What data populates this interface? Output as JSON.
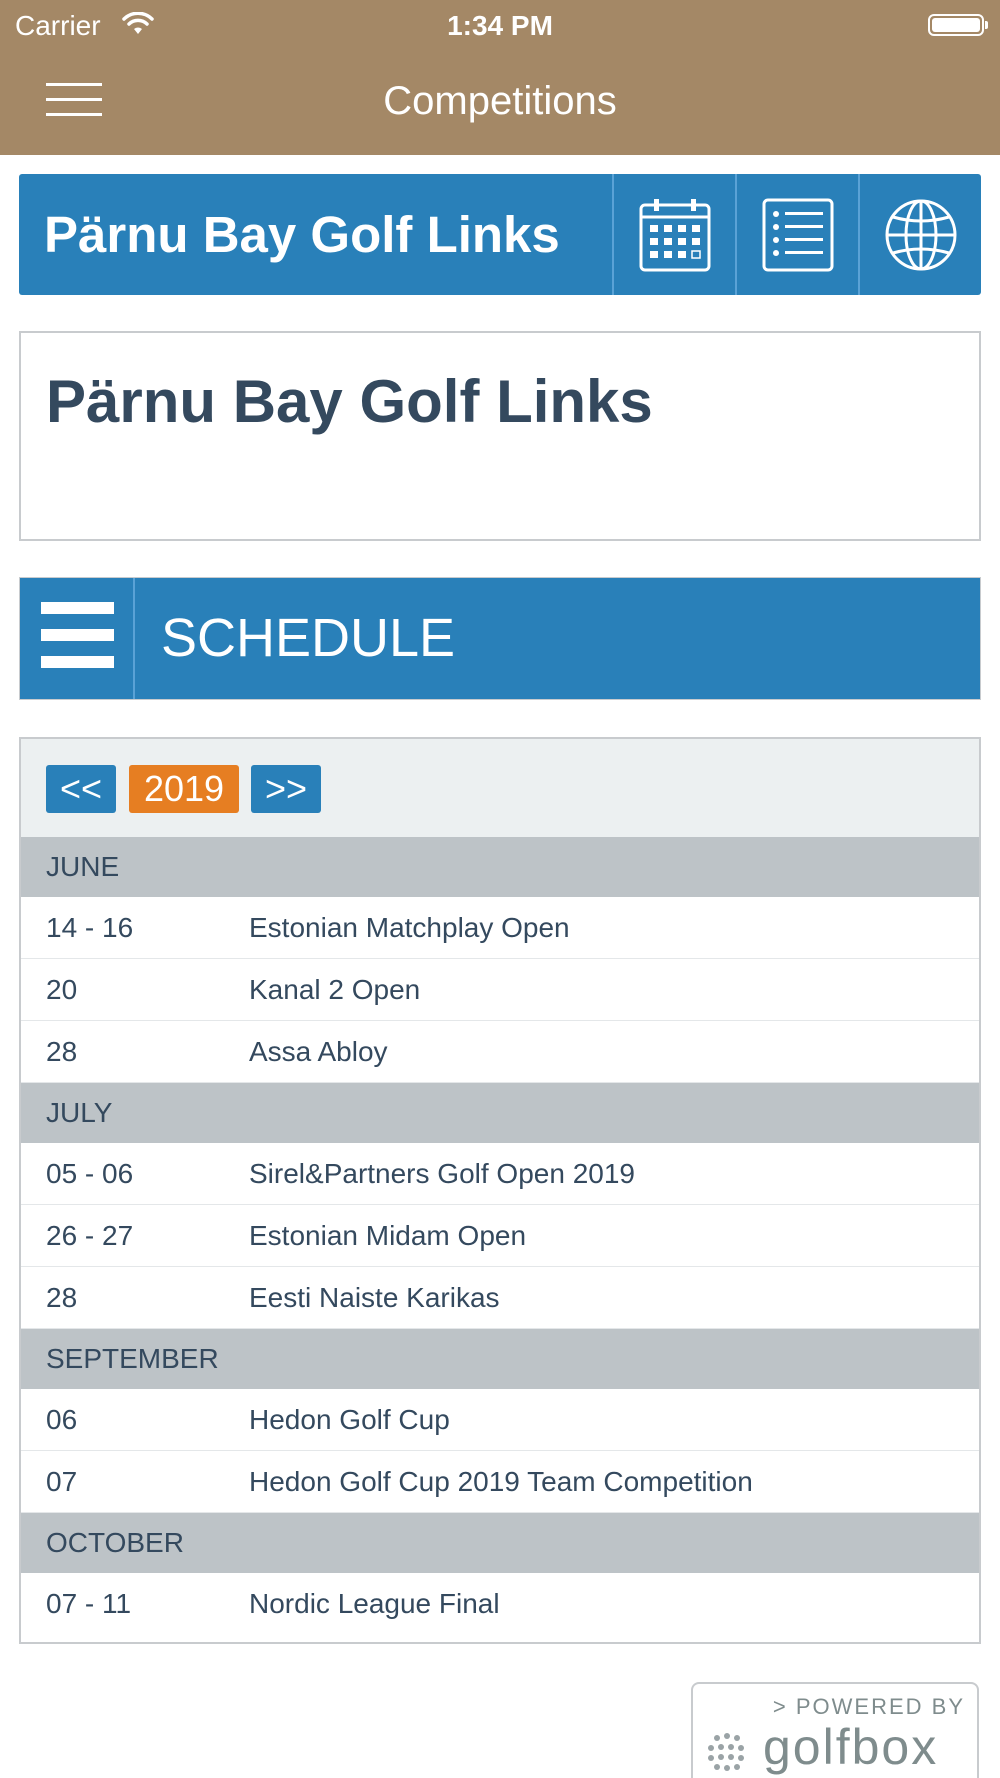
{
  "status_bar": {
    "carrier": "Carrier",
    "time": "1:34 PM",
    "icons": [
      "wifi-icon",
      "battery-icon"
    ]
  },
  "nav_bar": {
    "title": "Competitions",
    "menu_icon": "hamburger-menu-icon",
    "background_color": "#a48866"
  },
  "club_header": {
    "name": "Pärnu Bay Golf Links",
    "buttons": [
      "calendar-icon",
      "list-icon",
      "globe-icon"
    ],
    "background_color": "#2980b9"
  },
  "info_card": {
    "title": "Pärnu Bay Golf Links"
  },
  "schedule_header": {
    "title": "SCHEDULE",
    "menu_icon": "hamburger-menu-icon"
  },
  "schedule": {
    "prev_label": "<<",
    "year": "2019",
    "next_label": ">>",
    "year_color": "#e67e22",
    "months": [
      {
        "name": "JUNE",
        "competitions": [
          {
            "date": "14 - 16",
            "name": "Estonian Matchplay Open"
          },
          {
            "date": "20",
            "name": "Kanal 2 Open"
          },
          {
            "date": "28",
            "name": "Assa Abloy"
          }
        ]
      },
      {
        "name": "JULY",
        "competitions": [
          {
            "date": "05 - 06",
            "name": "Sirel&Partners Golf Open 2019"
          },
          {
            "date": "26 - 27",
            "name": "Estonian Midam Open"
          },
          {
            "date": "28",
            "name": "Eesti Naiste Karikas"
          }
        ]
      },
      {
        "name": "SEPTEMBER",
        "competitions": [
          {
            "date": "06",
            "name": "Hedon Golf Cup"
          },
          {
            "date": "07",
            "name": "Hedon Golf Cup 2019 Team Competition"
          }
        ]
      },
      {
        "name": "OCTOBER",
        "competitions": [
          {
            "date": "07 - 11",
            "name": "Nordic League Final"
          }
        ]
      }
    ]
  },
  "footer": {
    "powered_by": "> POWERED BY",
    "brand": "golfbox"
  }
}
